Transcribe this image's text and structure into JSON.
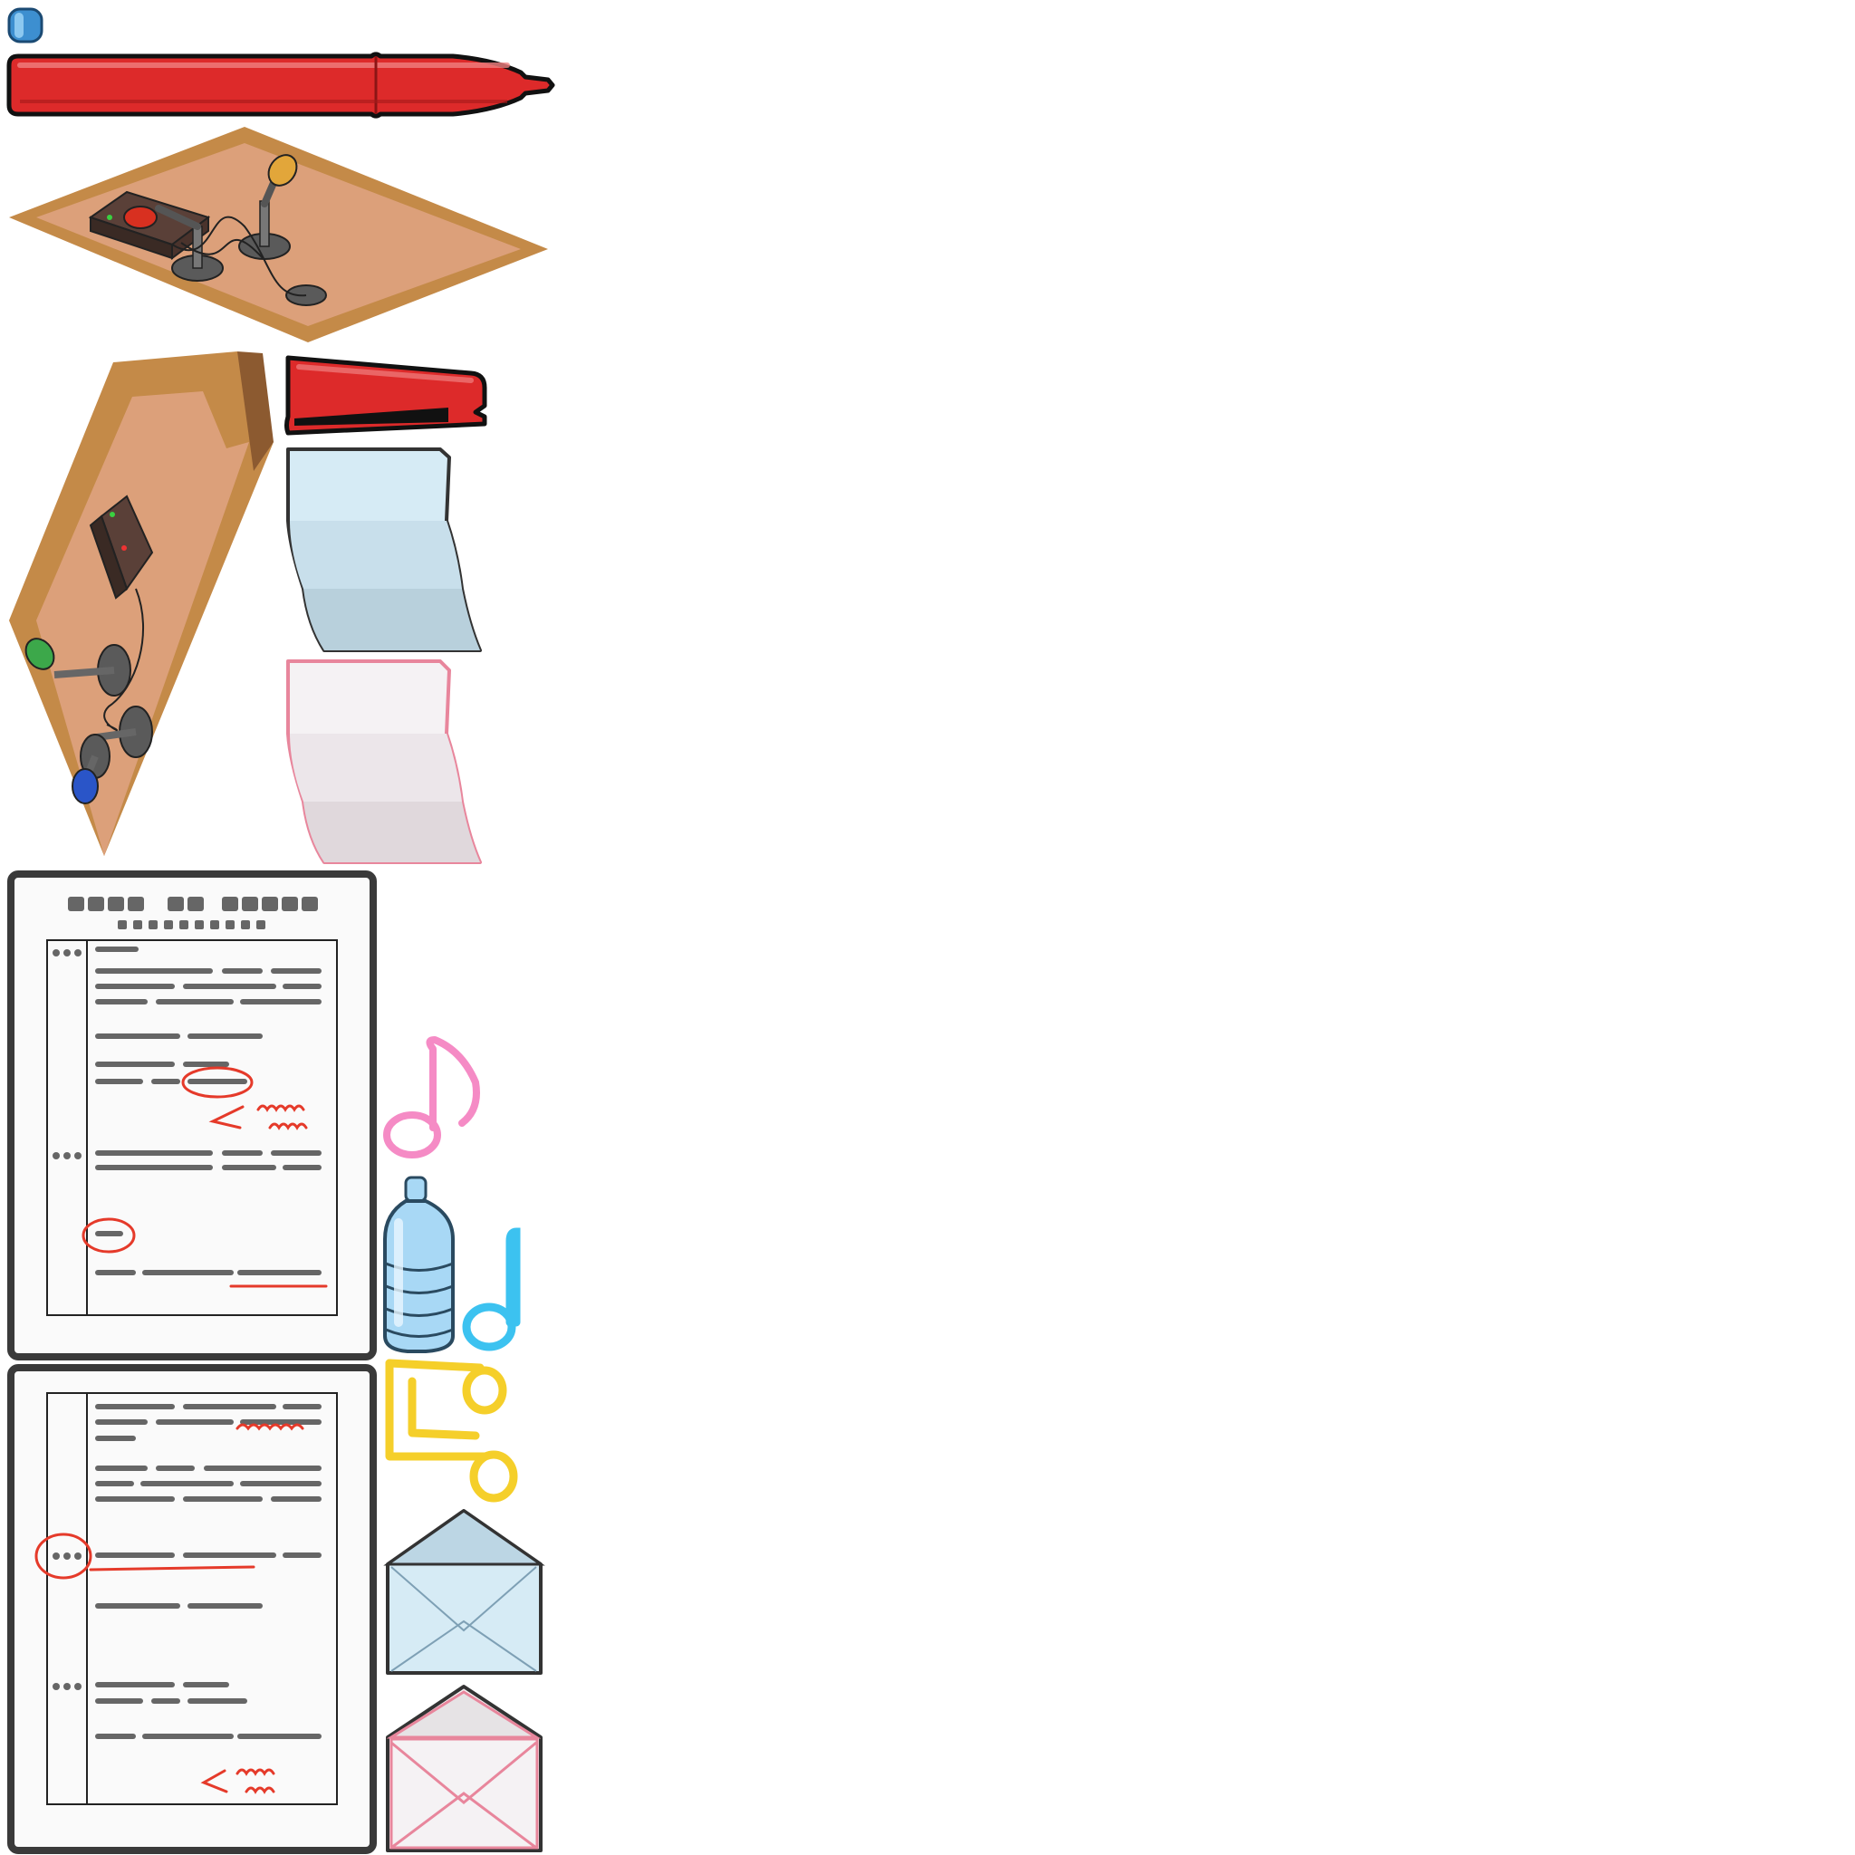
{
  "sprite_sheet": {
    "background": "#ffffff",
    "sprites": [
      {
        "name": "blue-pen-cap-sprite",
        "kind": "pen-cap"
      },
      {
        "name": "red-marker-sprite",
        "kind": "marker"
      },
      {
        "name": "desk-with-microphones-sprite",
        "kind": "isometric-desk"
      },
      {
        "name": "desk-with-microphones-rotated-sprite",
        "kind": "isometric-desk"
      },
      {
        "name": "red-stapler-sprite",
        "kind": "stapler"
      },
      {
        "name": "blue-folded-paper-sprite",
        "kind": "folded-paper"
      },
      {
        "name": "pink-folded-paper-sprite",
        "kind": "folded-paper"
      },
      {
        "name": "marked-document-sprite",
        "kind": "document"
      },
      {
        "name": "marked-document-page-two-sprite",
        "kind": "document"
      },
      {
        "name": "pink-music-note-icon",
        "kind": "music-note"
      },
      {
        "name": "water-bottle-sprite",
        "kind": "bottle"
      },
      {
        "name": "blue-music-note-icon",
        "kind": "music-note"
      },
      {
        "name": "yellow-double-note-icon",
        "kind": "music-note"
      },
      {
        "name": "blue-envelope-sprite",
        "kind": "envelope"
      },
      {
        "name": "pink-envelope-sprite",
        "kind": "envelope"
      }
    ]
  },
  "colors": {
    "marker_red": "#dd2a2a",
    "outline": "#222222",
    "wood_light": "#dca07a",
    "wood_edge": "#c48a48",
    "paper_blue": "#d6ebf5",
    "paper_pink": "#f3eef1",
    "doc_frame": "#3a3a3a",
    "doc_ink": "#666666",
    "red_markup": "#e53a2a",
    "note_pink": "#f58bc5",
    "note_blue": "#3cc2f0",
    "note_yellow": "#f5cf2a",
    "bottle_blue": "#a8d8f5"
  }
}
